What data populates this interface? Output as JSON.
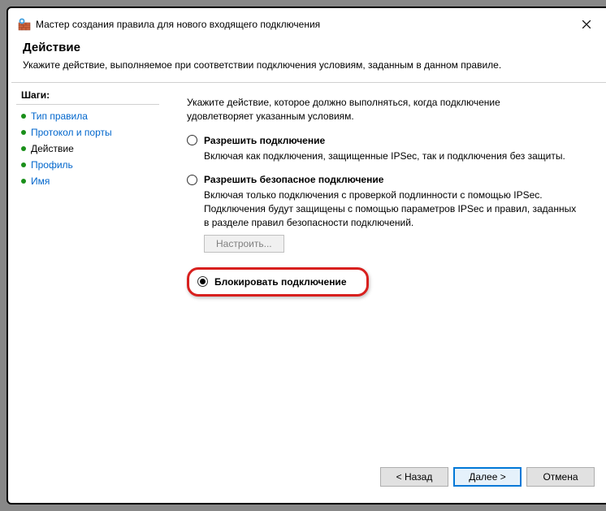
{
  "titlebar": {
    "title": "Мастер создания правила для нового входящего подключения"
  },
  "header": {
    "title": "Действие",
    "description": "Укажите действие, выполняемое при соответствии подключения условиям, заданным в данном правиле."
  },
  "sidebar": {
    "steps_label": "Шаги:",
    "items": [
      {
        "label": "Тип правила"
      },
      {
        "label": "Протокол и порты"
      },
      {
        "label": "Действие"
      },
      {
        "label": "Профиль"
      },
      {
        "label": "Имя"
      }
    ]
  },
  "content": {
    "description": "Укажите действие, которое должно выполняться, когда подключение удовлетворяет указанным условиям.",
    "options": [
      {
        "label": "Разрешить подключение",
        "desc": "Включая как подключения, защищенные IPSec, так и подключения без защиты."
      },
      {
        "label": "Разрешить безопасное подключение",
        "desc": "Включая только подключения с проверкой подлинности с помощью IPSec. Подключения будут защищены с помощью параметров IPSec и правил, заданных в разделе правил безопасности подключений.",
        "config_btn": "Настроить..."
      },
      {
        "label": "Блокировать подключение"
      }
    ]
  },
  "footer": {
    "back": "< Назад",
    "next": "Далее >",
    "cancel": "Отмена"
  }
}
